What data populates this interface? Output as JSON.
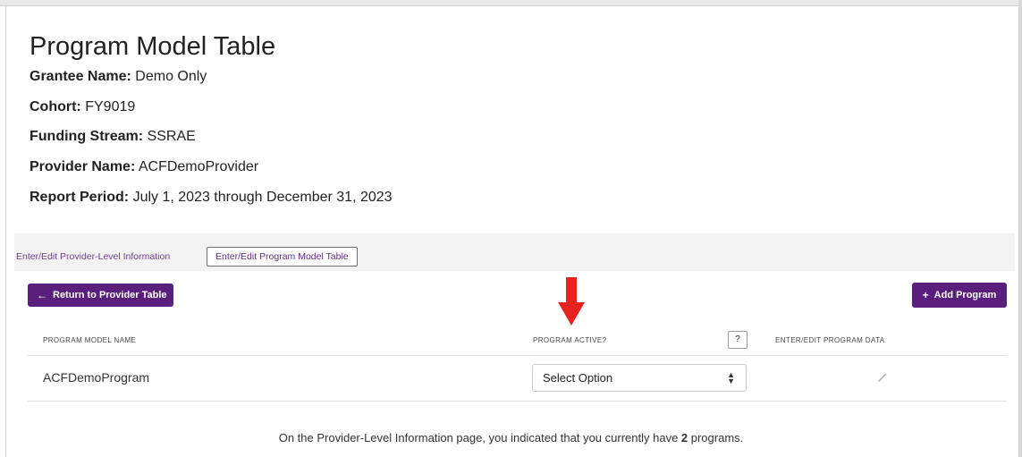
{
  "page": {
    "title": "Program Model Table"
  },
  "info": [
    {
      "label": "Grantee Name:",
      "value": "Demo Only"
    },
    {
      "label": "Cohort:",
      "value": "FY9019"
    },
    {
      "label": "Funding Stream:",
      "value": "SSRAE"
    },
    {
      "label": "Provider Name:",
      "value": "ACFDemoProvider"
    },
    {
      "label": "Report Period:",
      "value": "July 1, 2023 through December 31, 2023"
    }
  ],
  "tabs": [
    {
      "label": "Enter/Edit Provider-Level Information",
      "active": false
    },
    {
      "label": "Enter/Edit Program Model Table",
      "active": true
    }
  ],
  "actions": {
    "return_label": "Return to Provider Table",
    "return_icon": "arrow-left-icon",
    "add_label": "Add Program",
    "add_icon": "plus-icon"
  },
  "table": {
    "headers": [
      "PROGRAM MODEL NAME",
      "PROGRAM ACTIVE?",
      "ENTER/EDIT PROGRAM DATA"
    ],
    "help_label": "?",
    "rows": [
      {
        "name": "ACFDemoProgram",
        "active_value": "Select Option"
      }
    ]
  },
  "note": {
    "prefix": "On the Provider-Level Information page, you indicated that you currently have ",
    "count": "2",
    "suffix": " programs."
  },
  "colors": {
    "brand_purple": "#5a1f7d",
    "annotation_arrow": "#e8231f"
  }
}
